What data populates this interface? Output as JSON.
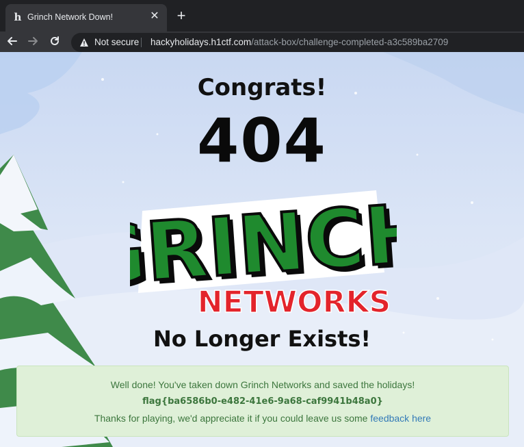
{
  "browser": {
    "tab_title": "Grinch Network Down!",
    "favicon_letter": "h",
    "close_glyph": "✕",
    "newtab_glyph": "+",
    "security_label": "Not secure",
    "url_host": "hackyholidays.h1ctf.com",
    "url_path": "/attack-box/challenge-completed-a3c589ba2709"
  },
  "page": {
    "heading": "Congrats!",
    "code": "404",
    "logo": {
      "line1": "GRINCH",
      "line2": "NETWORKS"
    },
    "subheading": "No Longer Exists!"
  },
  "alert": {
    "message": "Well done! You've taken down Grinch Networks and saved the holidays!",
    "flag": "flag{ba6586b0-e482-41e6-9a68-caf9941b48a0}",
    "thanks_text": "Thanks for playing, we'd appreciate it if you could leave us some ",
    "feedback_link": "feedback here"
  },
  "colors": {
    "alert_bg": "#dff0d8",
    "alert_text": "#3c763d",
    "link": "#337ab7",
    "logo_green": "#1f8a2e",
    "logo_red": "#e3242b"
  },
  "icons": [
    "back-arrow-icon",
    "forward-arrow-icon",
    "reload-icon",
    "warning-triangle-icon",
    "close-icon",
    "plus-icon"
  ]
}
